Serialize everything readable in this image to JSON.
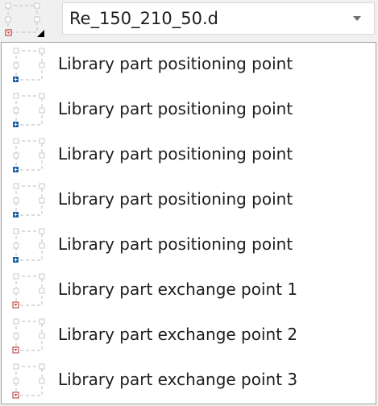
{
  "combo": {
    "value": "Re_150_210_50.d",
    "icon": "exchange-point-icon"
  },
  "options": [
    {
      "label": "Library part positioning point",
      "icon": "positioning-point-icon"
    },
    {
      "label": "Library part positioning point",
      "icon": "positioning-point-icon"
    },
    {
      "label": "Library part positioning point",
      "icon": "positioning-point-icon"
    },
    {
      "label": "Library part positioning point",
      "icon": "positioning-point-icon"
    },
    {
      "label": "Library part positioning point",
      "icon": "positioning-point-icon"
    },
    {
      "label": "Library part exchange point 1",
      "icon": "exchange-point-icon"
    },
    {
      "label": "Library part exchange point 2",
      "icon": "exchange-point-icon"
    },
    {
      "label": "Library part exchange point 3",
      "icon": "exchange-point-icon"
    }
  ],
  "colors": {
    "positioning_marker": "#1f5fa8",
    "exchange_marker": "#c0504d",
    "frame_dash": "#c8c8c8"
  }
}
